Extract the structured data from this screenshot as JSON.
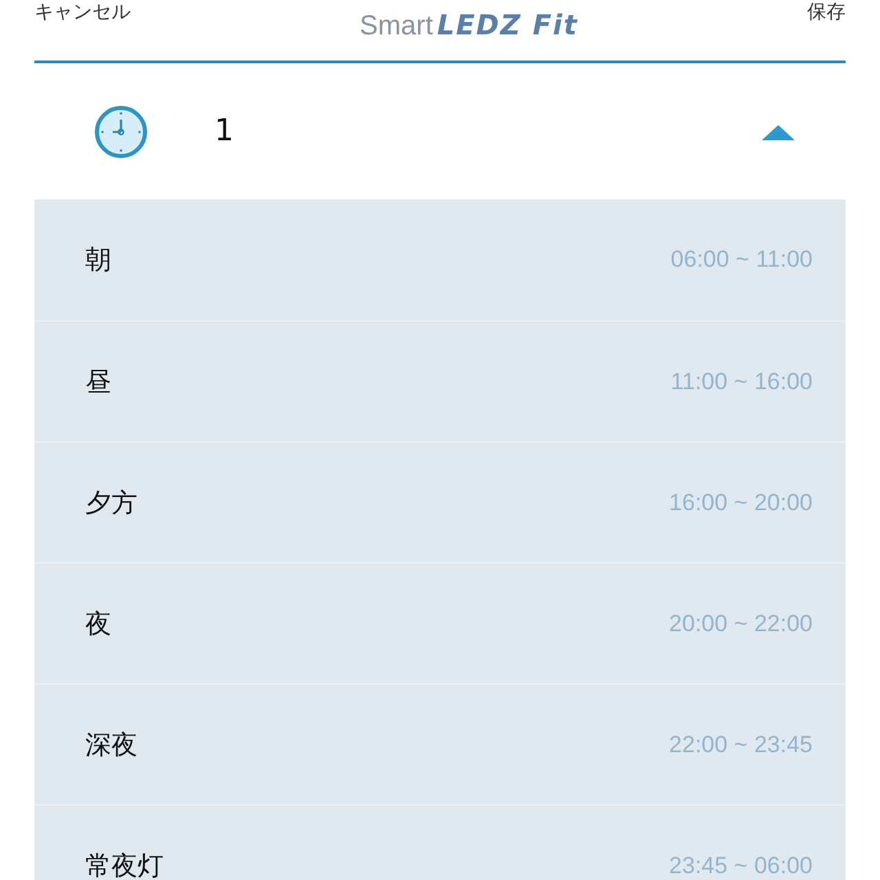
{
  "header": {
    "cancel": "キャンセル",
    "logo_light": "Smart",
    "logo_bold": "LEDZ Fit",
    "save": "保存"
  },
  "schedule": {
    "label": "1",
    "expanded": true
  },
  "periods": [
    {
      "name": "朝",
      "time": "06:00 ~ 11:00"
    },
    {
      "name": "昼",
      "time": "11:00 ~ 16:00"
    },
    {
      "name": "夕方",
      "time": "16:00 ~ 20:00"
    },
    {
      "name": "夜",
      "time": "20:00 ~ 22:00"
    },
    {
      "name": "深夜",
      "time": "22:00 ~ 23:45"
    },
    {
      "name": "常夜灯",
      "time": "23:45 ~ 06:00"
    }
  ]
}
